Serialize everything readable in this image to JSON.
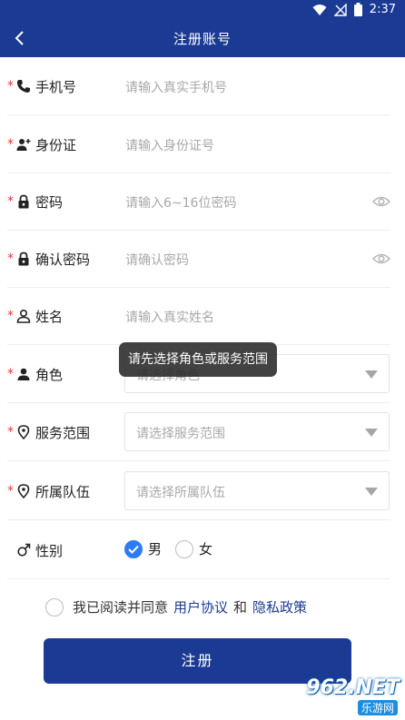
{
  "status_bar": {
    "time": "2:37",
    "icons": [
      "wifi-icon",
      "signal-icon",
      "battery-icon"
    ]
  },
  "app_bar": {
    "title": "注册账号",
    "back_icon": "chevron-left-icon"
  },
  "form": {
    "phone": {
      "required": "*",
      "label": "手机号",
      "placeholder": "请输入真实手机号",
      "icon": "phone-icon"
    },
    "id_card": {
      "required": "*",
      "label": "身份证",
      "placeholder": "请输入身份证号",
      "icon": "person-add-icon"
    },
    "password": {
      "required": "*",
      "label": "密码",
      "placeholder": "请输入6~16位密码",
      "icon": "lock-icon"
    },
    "confirm_password": {
      "required": "*",
      "label": "确认密码",
      "placeholder": "请确认密码",
      "icon": "lock-icon"
    },
    "name": {
      "required": "*",
      "label": "姓名",
      "placeholder": "请输入真实姓名",
      "icon": "person-outline-icon"
    },
    "role": {
      "required": "*",
      "label": "角色",
      "placeholder": "请选择角色",
      "icon": "person-icon"
    },
    "service_area": {
      "required": "*",
      "label": "服务范围",
      "placeholder": "请选择服务范围",
      "icon": "location-pin-icon"
    },
    "team": {
      "required": "*",
      "label": "所属队伍",
      "placeholder": "请选择所属队伍",
      "icon": "location-pin-icon"
    },
    "gender": {
      "label": "性别",
      "icon": "male-symbol-icon",
      "options": [
        "男",
        "女"
      ],
      "selected": "男"
    }
  },
  "toast": {
    "text": "请先选择角色或服务范围"
  },
  "agreement": {
    "prefix": "我已阅读并同意",
    "user_agreement": "用户协议",
    "and": "和",
    "privacy_policy": "隐私政策"
  },
  "submit": {
    "label": "注册"
  },
  "watermark": {
    "brand": "962.NET",
    "sub": "乐游网"
  },
  "colors": {
    "primary": "#1b3a93",
    "required": "#e23a3a",
    "checked": "#2d7cf6",
    "placeholder": "#a8a8a8"
  }
}
